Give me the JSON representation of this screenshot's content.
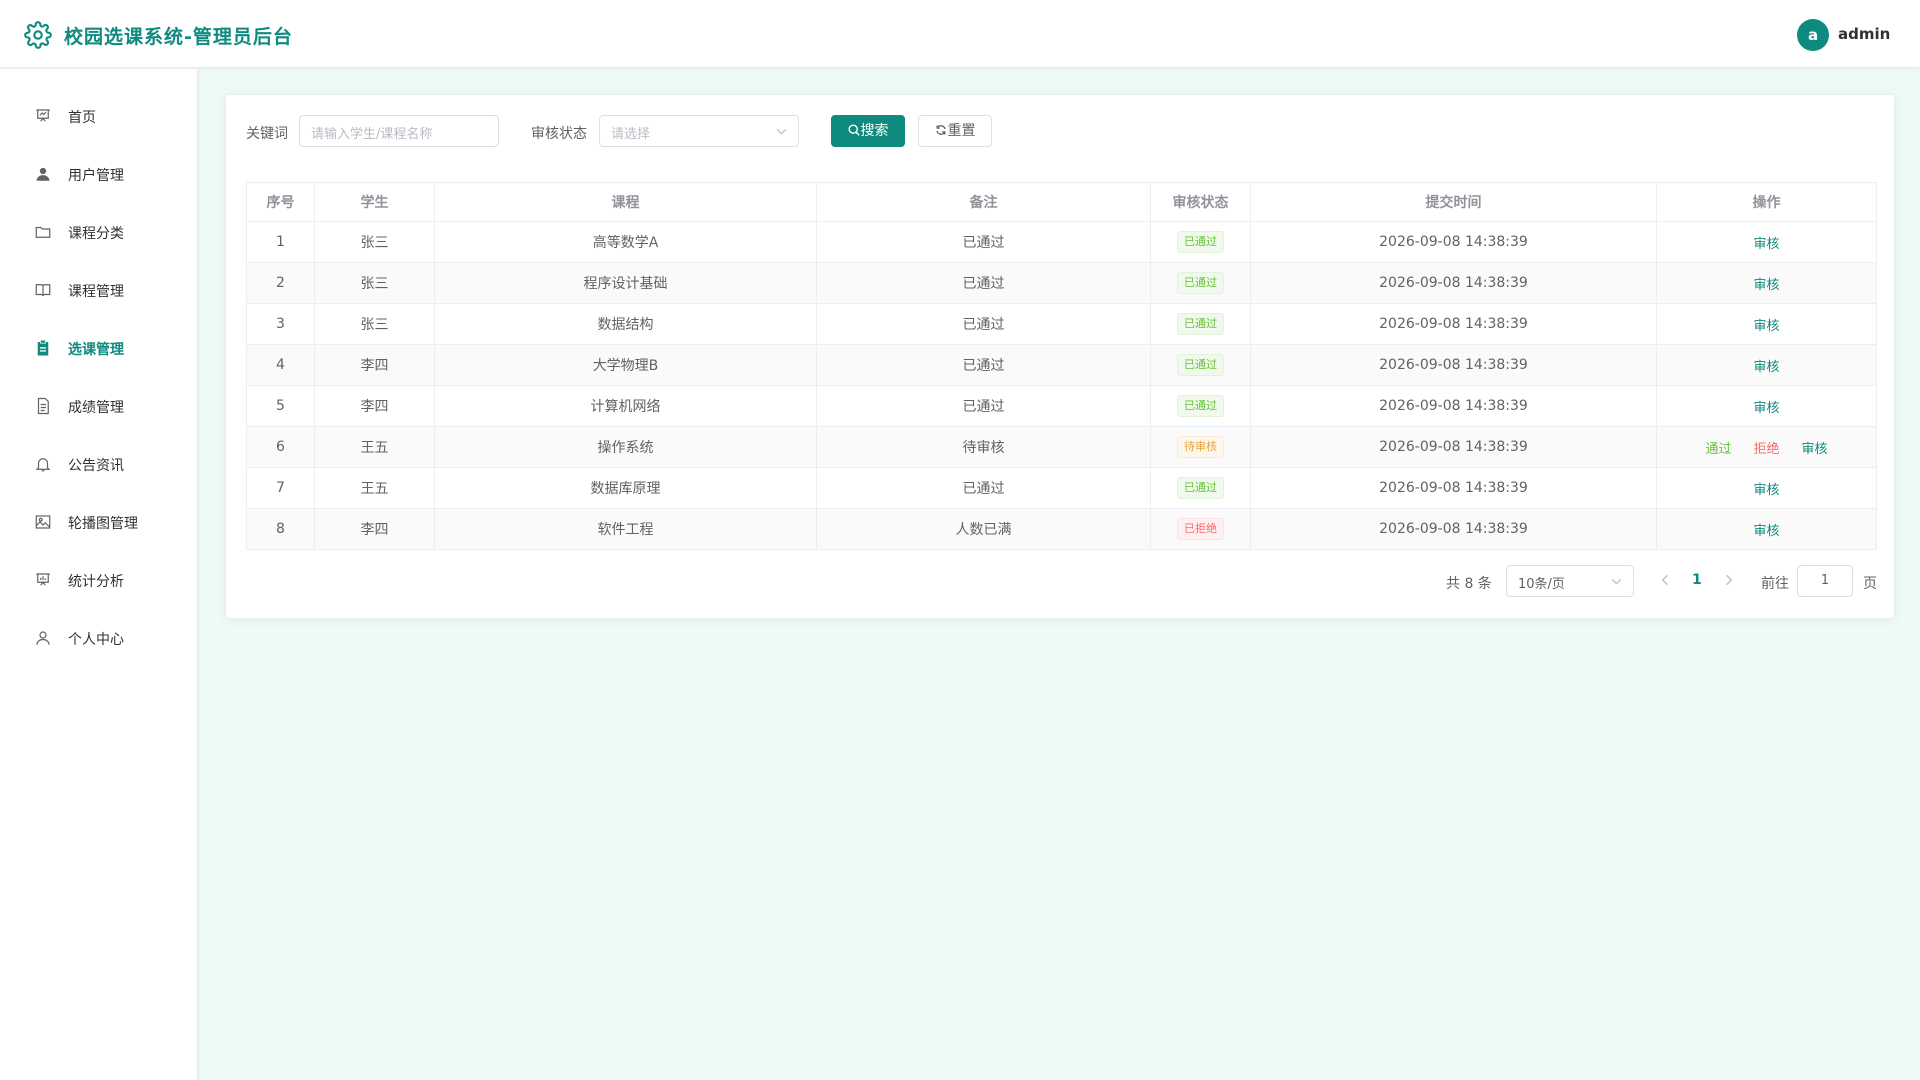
{
  "header": {
    "title": "校园选课系统-管理员后台",
    "avatar_letter": "a",
    "username": "admin"
  },
  "sidebar": {
    "items": [
      {
        "label": "首页",
        "icon": "presentation-icon"
      },
      {
        "label": "用户管理",
        "icon": "user-icon"
      },
      {
        "label": "课程分类",
        "icon": "folder-icon"
      },
      {
        "label": "课程管理",
        "icon": "book-icon"
      },
      {
        "label": "选课管理",
        "icon": "clipboard-icon",
        "active": true
      },
      {
        "label": "成绩管理",
        "icon": "document-icon"
      },
      {
        "label": "公告资讯",
        "icon": "bell-icon"
      },
      {
        "label": "轮播图管理",
        "icon": "picture-icon"
      },
      {
        "label": "统计分析",
        "icon": "chart-icon"
      },
      {
        "label": "个人中心",
        "icon": "user-outline-icon"
      }
    ]
  },
  "filters": {
    "keyword_label": "关键词",
    "keyword_placeholder": "请输入学生/课程名称",
    "status_label": "审核状态",
    "status_placeholder": "请选择",
    "search_label": "搜索",
    "reset_label": "重置"
  },
  "table": {
    "headers": [
      "序号",
      "学生",
      "课程",
      "备注",
      "审核状态",
      "提交时间",
      "操作"
    ],
    "rows": [
      {
        "no": "1",
        "student": "张三",
        "course": "高等数学A",
        "note": "已通过",
        "status": "已通过",
        "time": "2026-09-08 14:38:39"
      },
      {
        "no": "2",
        "student": "张三",
        "course": "程序设计基础",
        "note": "已通过",
        "status": "已通过",
        "time": "2026-09-08 14:38:39"
      },
      {
        "no": "3",
        "student": "张三",
        "course": "数据结构",
        "note": "已通过",
        "status": "已通过",
        "time": "2026-09-08 14:38:39"
      },
      {
        "no": "4",
        "student": "李四",
        "course": "大学物理B",
        "note": "已通过",
        "status": "已通过",
        "time": "2026-09-08 14:38:39"
      },
      {
        "no": "5",
        "student": "李四",
        "course": "计算机网络",
        "note": "已通过",
        "status": "已通过",
        "time": "2026-09-08 14:38:39"
      },
      {
        "no": "6",
        "student": "王五",
        "course": "操作系统",
        "note": "待审核",
        "status": "待审核",
        "time": "2026-09-08 14:38:39"
      },
      {
        "no": "7",
        "student": "王五",
        "course": "数据库原理",
        "note": "已通过",
        "status": "已通过",
        "time": "2026-09-08 14:38:39"
      },
      {
        "no": "8",
        "student": "李四",
        "course": "软件工程",
        "note": "人数已满",
        "status": "已拒绝",
        "time": "2026-09-08 14:38:39"
      }
    ],
    "actions": {
      "review": "审核",
      "approve": "通过",
      "reject": "拒绝"
    }
  },
  "pagination": {
    "total_text": "共 8 条",
    "page_size": "10条/页",
    "current_page": "1",
    "goto_label": "前往",
    "goto_value": "1",
    "page_unit": "页"
  },
  "colors": {
    "primary": "#0f8a7f",
    "success": "#67c23a",
    "warning": "#e6a23c",
    "danger": "#f56c6c",
    "background": "#eefaf8"
  }
}
